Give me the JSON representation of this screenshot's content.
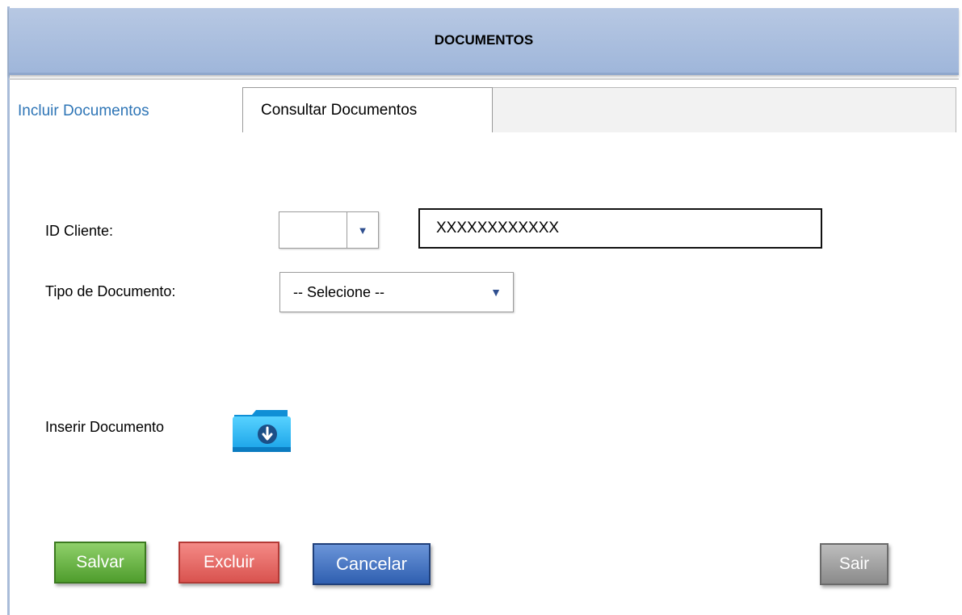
{
  "header": {
    "title": "DOCUMENTOS"
  },
  "tabs": [
    {
      "label": "Incluir Documentos",
      "active": true
    },
    {
      "label": "Consultar Documentos",
      "active": false
    }
  ],
  "form": {
    "id_cliente_label": "ID Cliente:",
    "id_cliente_select_value": "",
    "id_cliente_text_value": "XXXXXXXXXXXX",
    "tipo_documento_label": "Tipo de Documento:",
    "tipo_documento_value": "-- Selecione --",
    "inserir_documento_label": "Inserir Documento"
  },
  "icons": {
    "dropdown": "chevron-down-icon",
    "folder": "folder-download-icon"
  },
  "buttons": {
    "salvar": "Salvar",
    "excluir": "Excluir",
    "cancelar": "Cancelar",
    "sair": "Sair"
  },
  "colors": {
    "header_bg": "#a9bcd9",
    "active_tab_text": "#2e75b6",
    "salvar": "#5aab37",
    "excluir": "#e06662",
    "cancelar": "#3d6bbd",
    "sair": "#9a9a9a"
  }
}
